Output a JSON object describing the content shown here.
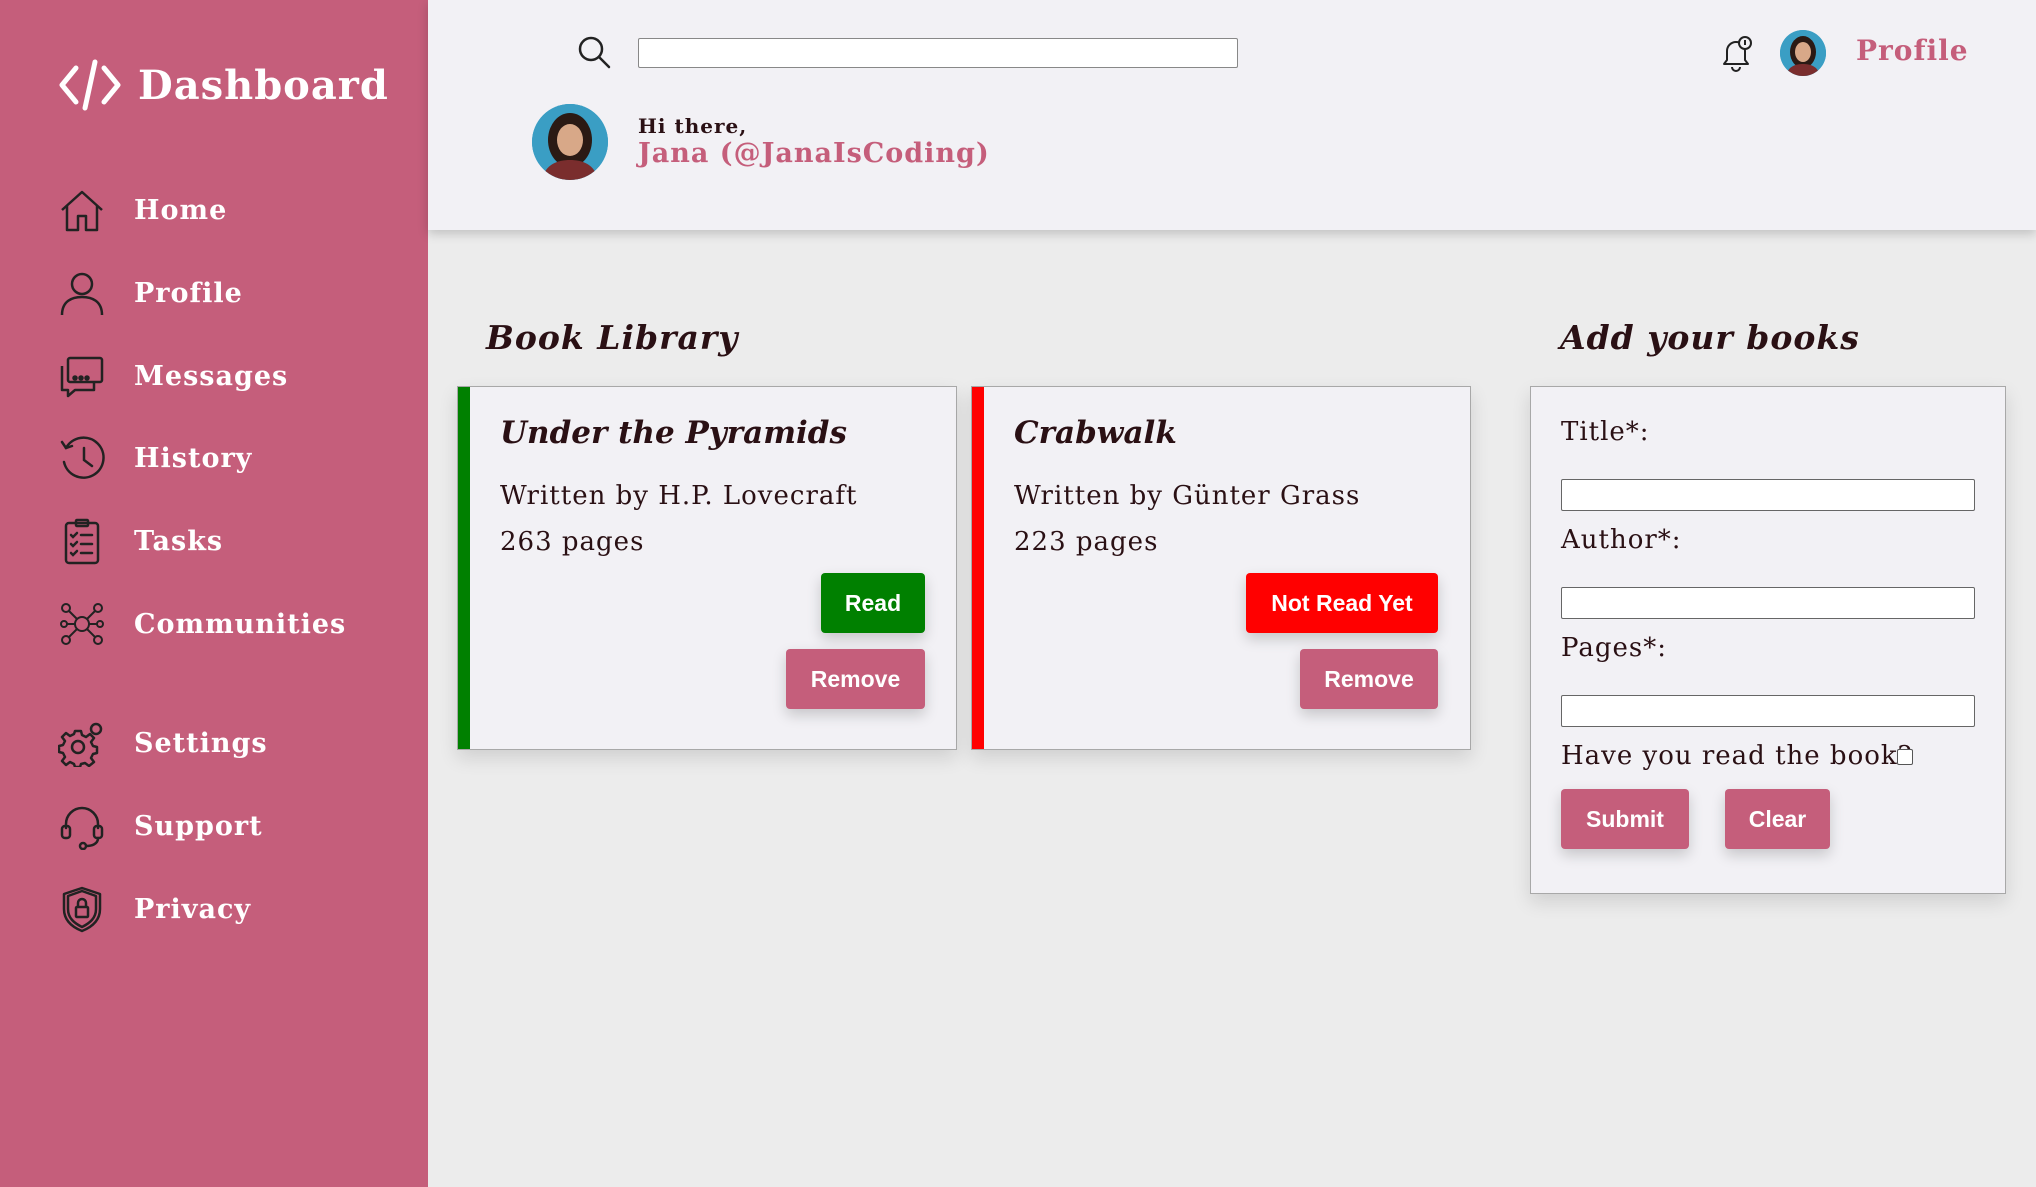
{
  "sidebar": {
    "brand": "Dashboard",
    "items": [
      {
        "label": "Home",
        "icon": "home-icon"
      },
      {
        "label": "Profile",
        "icon": "user-icon"
      },
      {
        "label": "Messages",
        "icon": "messages-icon"
      },
      {
        "label": "History",
        "icon": "history-icon"
      },
      {
        "label": "Tasks",
        "icon": "tasks-icon"
      },
      {
        "label": "Communities",
        "icon": "communities-icon"
      },
      {
        "label": "Settings",
        "icon": "gear-icon"
      },
      {
        "label": "Support",
        "icon": "headset-icon"
      },
      {
        "label": "Privacy",
        "icon": "shield-icon"
      }
    ]
  },
  "header": {
    "search_value": "",
    "profile_label": "Profile",
    "greeting": "Hi there,",
    "username": "Jana (@JanaIsCoding)"
  },
  "library": {
    "title": "Book Library",
    "books": [
      {
        "title": "Under the Pyramids",
        "author": "Written by H.P. Lovecraft",
        "pages": "263 pages",
        "status": "Read",
        "status_color": "#008000",
        "remove_label": "Remove"
      },
      {
        "title": "Crabwalk",
        "author": "Written by Günter Grass",
        "pages": "223 pages",
        "status": "Not Read Yet",
        "status_color": "#ff0000",
        "remove_label": "Remove"
      }
    ]
  },
  "form": {
    "title": "Add your books",
    "title_label": "Title*:",
    "author_label": "Author*:",
    "pages_label": "Pages*:",
    "read_label": "Have you read the book?",
    "read_checked": false,
    "submit_label": "Submit",
    "clear_label": "Clear"
  },
  "colors": {
    "accent": "#c55e7b",
    "read": "#008000",
    "not_read": "#ff0000",
    "background": "#ececec",
    "card": "#f2f1f5"
  }
}
